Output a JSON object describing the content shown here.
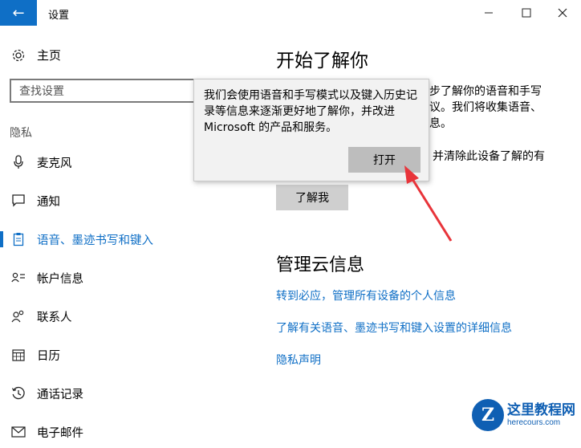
{
  "window": {
    "title": "设置"
  },
  "nav": {
    "home_label": "主页",
    "search_placeholder": "查找设置",
    "section_label": "隐私",
    "items": [
      {
        "label": "麦克风",
        "icon": "microphone-icon"
      },
      {
        "label": "通知",
        "icon": "notification-icon"
      },
      {
        "label": "语音、墨迹书写和键入",
        "icon": "clipboard-icon",
        "active": true
      },
      {
        "label": "帐户信息",
        "icon": "account-info-icon"
      },
      {
        "label": "联系人",
        "icon": "contacts-icon"
      },
      {
        "label": "日历",
        "icon": "calendar-icon"
      },
      {
        "label": "通话记录",
        "icon": "history-icon"
      },
      {
        "label": "电子邮件",
        "icon": "mail-icon"
      }
    ]
  },
  "content": {
    "heading": "开始了解你",
    "para_frags": [
      "步了解你的语音和手写",
      "议。我们将收集语音、",
      "息。",
      "并清除此设备了解的有"
    ],
    "learn_button": "了解我",
    "heading2": "管理云信息",
    "links": [
      "转到必应，管理所有设备的个人信息",
      "了解有关语音、墨迹书写和键入设置的详细信息",
      "隐私声明"
    ]
  },
  "popup": {
    "text": "我们会使用语音和手写模式以及键入历史记录等信息来逐渐更好地了解你，并改进 Microsoft 的产品和服务。",
    "button": "打开"
  },
  "watermark": {
    "logo_letter": "Z",
    "name": "这里教程网",
    "url": "herecours.com"
  },
  "colors": {
    "accent": "#0f6fc6",
    "arrow": "#e8343a"
  }
}
